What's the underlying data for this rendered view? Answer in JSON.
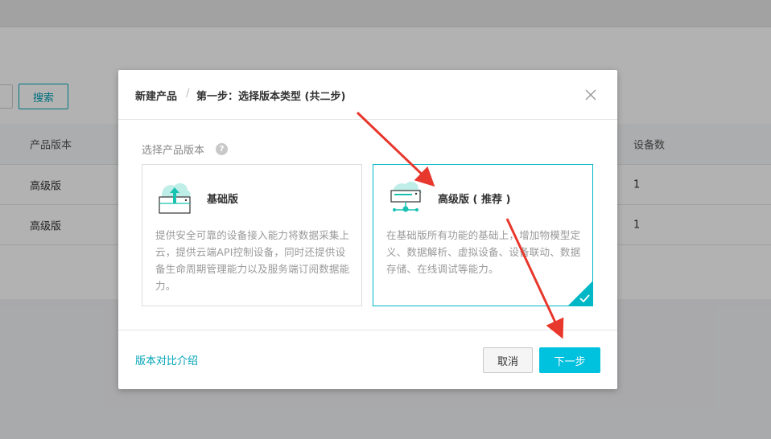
{
  "background": {
    "search_button": "搜索",
    "table": {
      "headers": [
        "产品版本",
        "设备数"
      ],
      "rows": [
        {
          "version": "高级版",
          "count": "1"
        },
        {
          "version": "高级版",
          "count": "1"
        }
      ]
    }
  },
  "modal": {
    "title": "新建产品",
    "separator": "/",
    "step": "第一步：选择版本类型 (共二步)",
    "section_label": "选择产品版本",
    "help_icon": "?",
    "cards": [
      {
        "title": "基础版",
        "description": "提供安全可靠的设备接入能力将数据采集上云，提供云端API控制设备，同时还提供设备生命周期管理能力以及服务端订阅数据能力。",
        "icon": "cloud-upload-icon",
        "selected": false
      },
      {
        "title": "高级版 ( 推荐 )",
        "description": "在基础版所有功能的基础上，增加物模型定义、数据解析、虚拟设备、设备联动、数据存储、在线调试等能力。",
        "icon": "cloud-network-icon",
        "selected": true
      }
    ],
    "footer": {
      "compare_link": "版本对比介绍",
      "cancel": "取消",
      "next": "下一步"
    }
  },
  "colors": {
    "accent": "#00c1de",
    "link": "#00a3b7",
    "annotation_arrow": "#e8372c"
  }
}
